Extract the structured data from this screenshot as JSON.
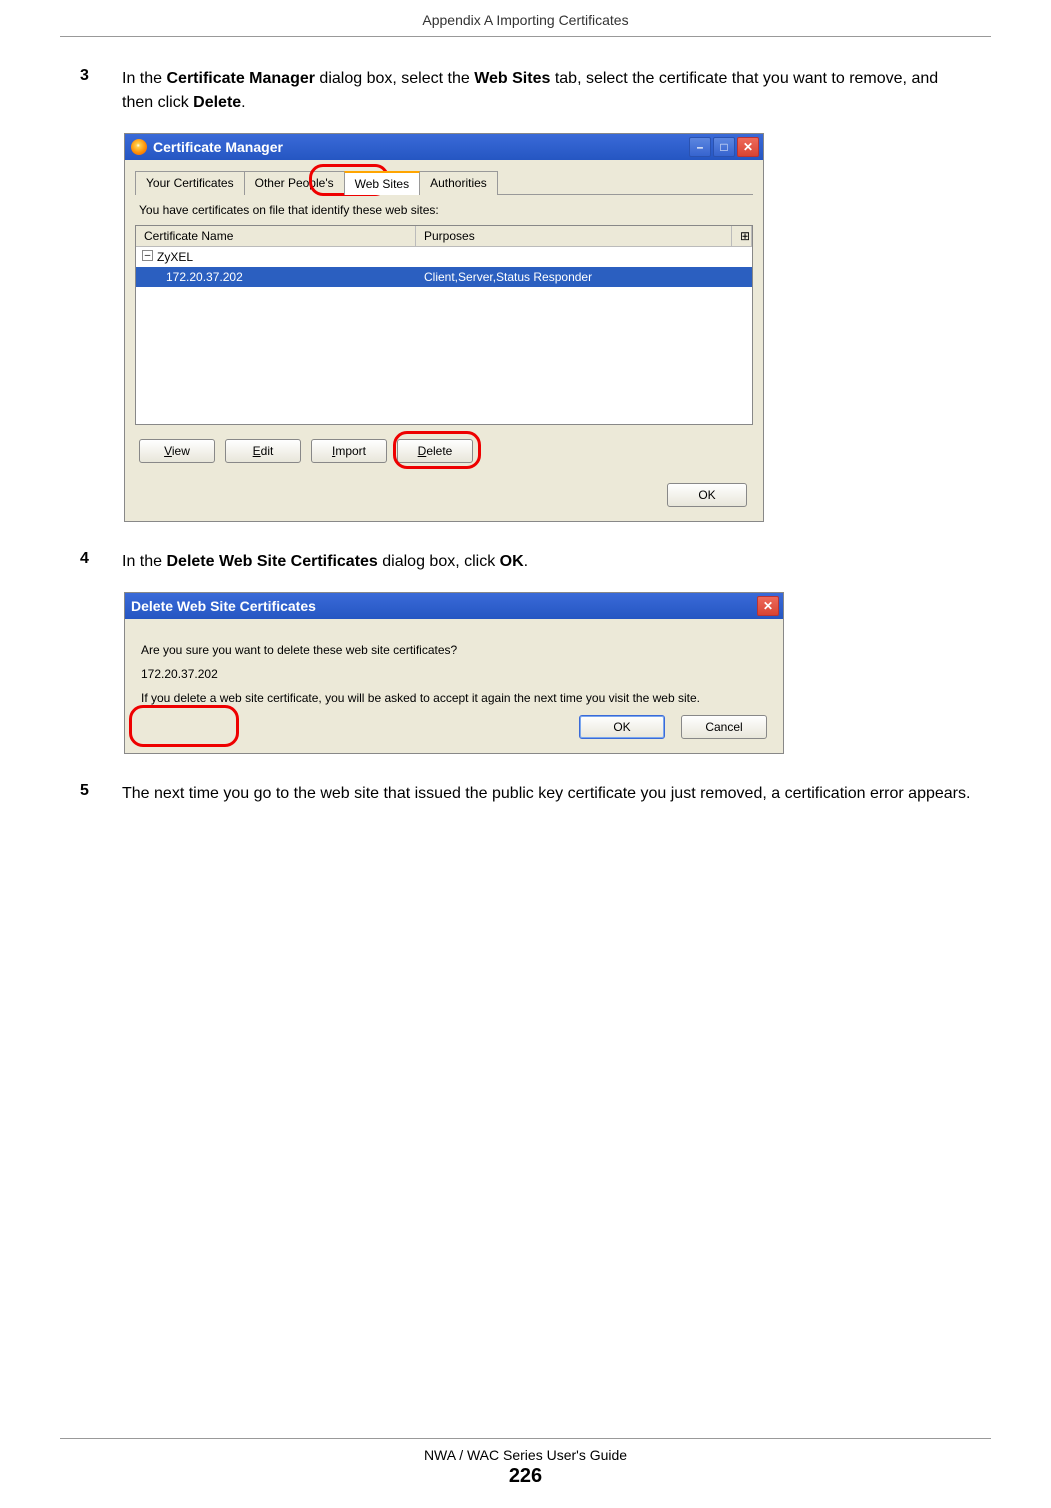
{
  "header": {
    "title": "Appendix A Importing Certificates"
  },
  "steps": {
    "s3": {
      "num": "3",
      "parts": [
        "In the ",
        "Certificate Manager",
        " dialog box, select the ",
        "Web Sites",
        " tab, select the certificate that you want to remove, and then click ",
        "Delete",
        "."
      ]
    },
    "s4": {
      "num": "4",
      "parts": [
        "In the ",
        "Delete Web Site Certificates",
        " dialog box, click ",
        "OK",
        "."
      ]
    },
    "s5": {
      "num": "5",
      "text": "The next time you go to the web site that issued the public key certificate you just removed, a certification error appears."
    }
  },
  "win1": {
    "title": "Certificate Manager",
    "tabs": [
      "Your Certificates",
      "Other People's",
      "Web Sites",
      "Authorities"
    ],
    "activeTab": 2,
    "description": "You have certificates on file that identify these web sites:",
    "columns": {
      "name": "Certificate Name",
      "purpose": "Purposes"
    },
    "group": "ZyXEL",
    "cert": {
      "name": "172.20.37.202",
      "purpose": "Client,Server,Status Responder"
    },
    "buttons": {
      "view": "View",
      "edit": "Edit",
      "import": "Import",
      "delete": "Delete",
      "ok": "OK"
    }
  },
  "win2": {
    "title": "Delete Web Site Certificates",
    "question": "Are you sure you want to delete these web site certificates?",
    "item": "172.20.37.202",
    "warning": "If you delete a web site certificate, you will be asked to accept it again the next time you visit the web site.",
    "buttons": {
      "ok": "OK",
      "cancel": "Cancel"
    }
  },
  "footer": {
    "guide": "NWA / WAC Series User's Guide",
    "page": "226"
  }
}
